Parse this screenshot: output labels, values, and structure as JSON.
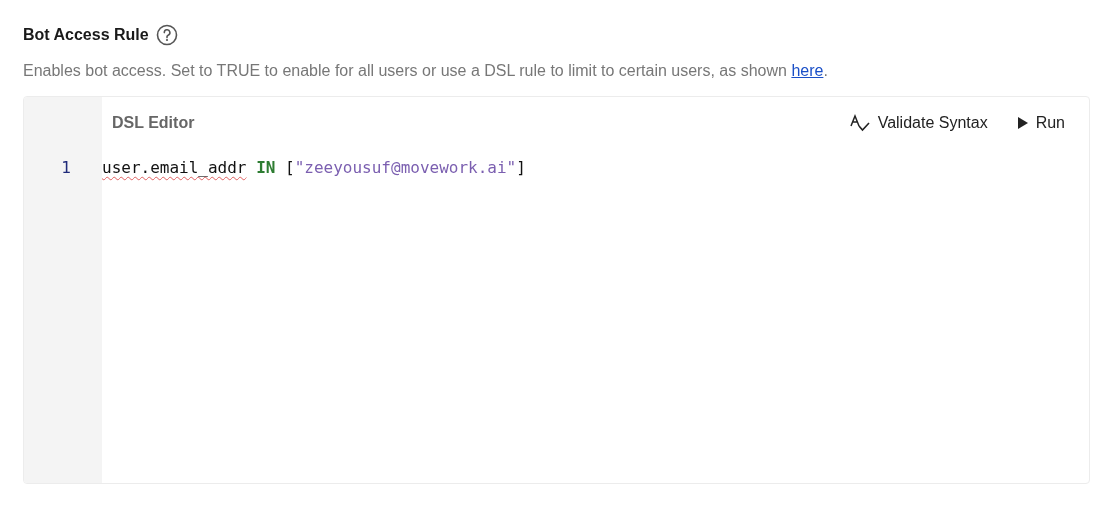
{
  "section": {
    "title": "Bot Access Rule",
    "description": {
      "text": "Enables bot access. Set to TRUE to enable for all users or use a DSL rule to limit to certain users, as shown ",
      "link": "here",
      "after": "."
    }
  },
  "editor": {
    "title": "DSL Editor",
    "actions": [
      {
        "kind": "validate",
        "label": "Validate Syntax"
      },
      {
        "kind": "run",
        "label": "Run"
      }
    ],
    "lines": [
      {
        "number": "1",
        "tokens": [
          {
            "kind": "identifier",
            "text": "user.email_addr",
            "flagged": true
          },
          {
            "kind": "keyword",
            "text": " IN",
            "flagged": false
          },
          {
            "kind": "plain",
            "text": " [",
            "flagged": false
          },
          {
            "kind": "string",
            "text": "\"zeeyousuf@movework.ai\"",
            "flagged": false
          },
          {
            "kind": "plain",
            "text": "]",
            "flagged": false
          }
        ]
      }
    ]
  }
}
